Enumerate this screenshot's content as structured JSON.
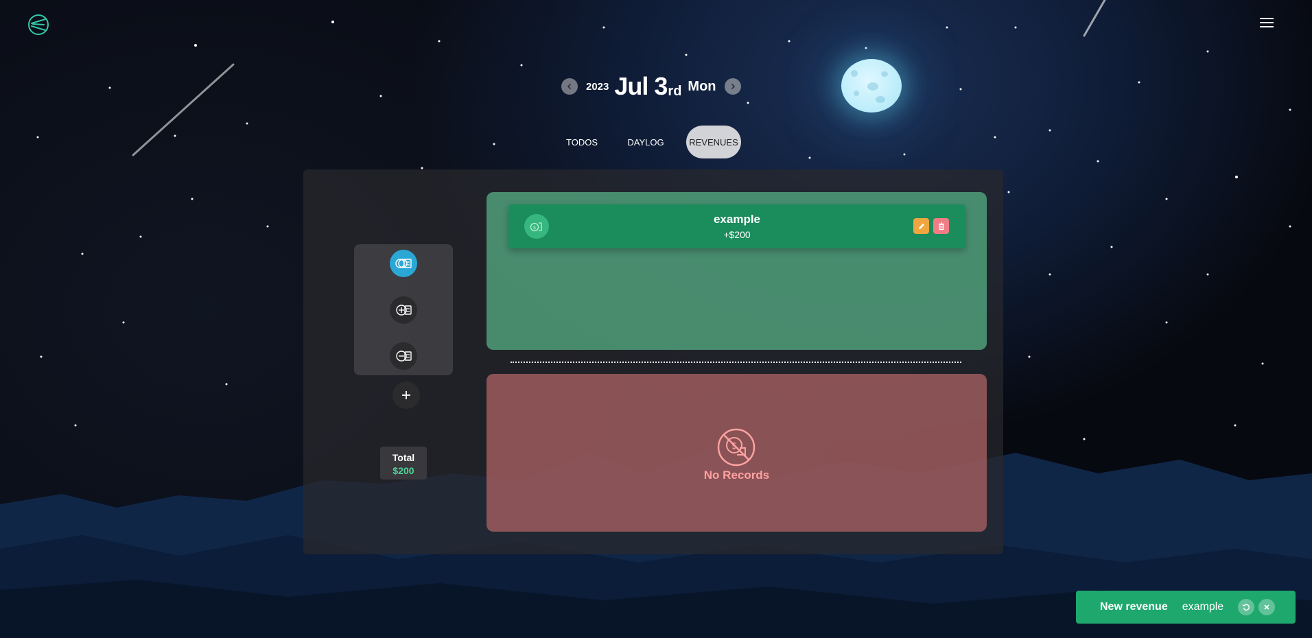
{
  "date": {
    "year": "2023",
    "day": "Jul 3",
    "suffix": "rd",
    "weekday": "Mon",
    "prev_icon": "chevron-left-icon",
    "next_icon": "chevron-right-icon"
  },
  "tabs": [
    {
      "label": "TODOS",
      "active": false
    },
    {
      "label": "DAYLOG",
      "active": false
    },
    {
      "label": "REVENUES",
      "active": true
    }
  ],
  "sidebar": {
    "buttons": [
      {
        "icon": "all-revenues-icon",
        "active": true
      },
      {
        "icon": "income-icon",
        "active": false
      },
      {
        "icon": "expense-icon",
        "active": false
      }
    ],
    "add_icon": "plus-icon"
  },
  "total": {
    "label": "Total",
    "value": "$200"
  },
  "income": {
    "records": [
      {
        "title": "example",
        "amount": "+$200",
        "icon": "money-bag-icon"
      }
    ]
  },
  "expense": {
    "empty_label": "No Records",
    "empty_icon": "no-money-icon"
  },
  "toast": {
    "title": "New revenue",
    "message": "example",
    "undo_icon": "undo-icon",
    "close_icon": "close-icon"
  },
  "colors": {
    "income_bg": "#56af84",
    "income_card": "#1b8c5c",
    "expense_bg": "#a86062",
    "active_accent": "#2aa7d4",
    "total_value": "#4cd69a",
    "edit": "#f0a640",
    "delete": "#f07d86",
    "toast_bg": "#1fa86e"
  }
}
